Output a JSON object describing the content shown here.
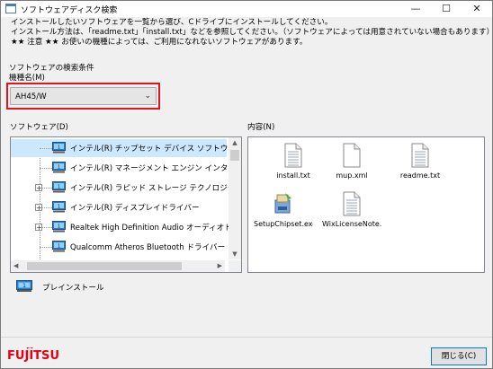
{
  "window": {
    "title": "ソフトウェアディスク検索",
    "minimize_glyph": "—",
    "maximize_glyph": "☐",
    "close_glyph": "✕"
  },
  "description": {
    "line1": "インストールしたいソフトウェアを一覧から選び、Cドライブにインストールしてください。",
    "line2": "インストール方法は、「readme.txt」「install.txt」などを参照してください。（ソフトウェアによっては用意されていない場合もあります）",
    "line3": "★★ 注意 ★★ お使いの機種によっては、ご利用になれないソフトウェアがあります。"
  },
  "search": {
    "section_label": "ソフトウェアの検索条件",
    "model_label": "機種名(M)",
    "model_value": "AH45/W",
    "highlight_color": "#e0151f"
  },
  "software": {
    "label": "ソフトウェア(D)",
    "items": [
      {
        "label": "インテル(R) チップセット デバイス ソフトウェア",
        "expandable": false,
        "selected": true
      },
      {
        "label": "インテル(R) マネージメント エンジン インターフェイス",
        "expandable": false,
        "selected": false
      },
      {
        "label": "インテル(R) ラピッド ストレージ テクノロジー",
        "expandable": true,
        "selected": false
      },
      {
        "label": "インテル(R) ディスプレイドライバー",
        "expandable": true,
        "selected": false
      },
      {
        "label": "Realtek High Definition Audio オーディオドライバー",
        "expandable": true,
        "selected": false
      },
      {
        "label": "Qualcomm Atheros Bluetooth ドライバー",
        "expandable": false,
        "selected": false
      }
    ],
    "icon_name": "preinstall-icon",
    "expand_glyph": "+"
  },
  "contents": {
    "label": "内容(N)",
    "files": [
      {
        "name": "install.txt",
        "icon": "text-file-icon"
      },
      {
        "name": "mup.xml",
        "icon": "blank-file-icon"
      },
      {
        "name": "readme.txt",
        "icon": "text-file-icon"
      },
      {
        "name": "SetupChipset.exe",
        "icon": "installer-icon"
      },
      {
        "name": "WixLicenseNote.t...",
        "icon": "text-file-icon"
      }
    ]
  },
  "legend": {
    "label": "プレインストール"
  },
  "footer": {
    "logo_text": "FUJITSU",
    "close_label": "閉じる(C)",
    "brand_color": "#e60012"
  }
}
